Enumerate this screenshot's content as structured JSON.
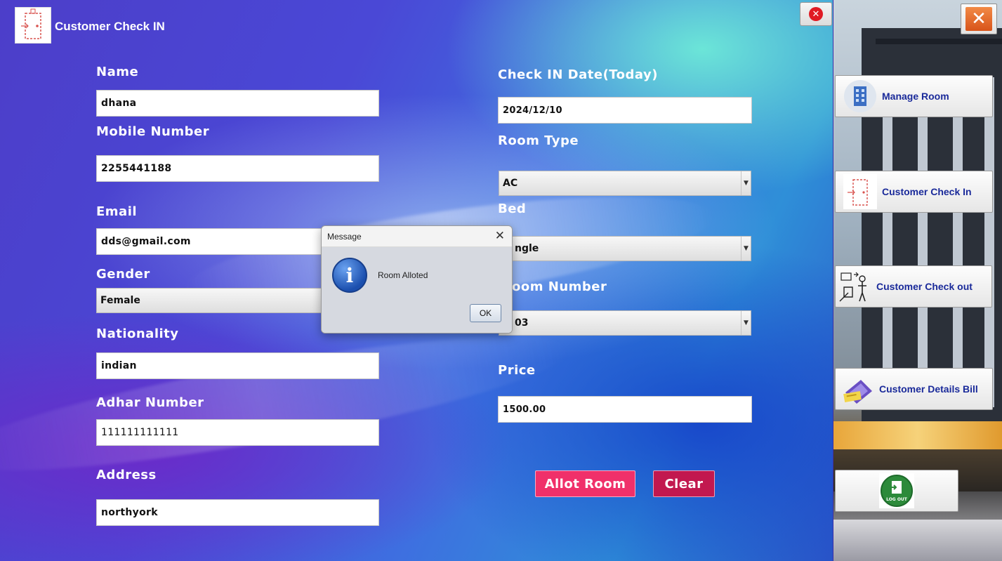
{
  "window": {
    "title": "Customer Check IN"
  },
  "form": {
    "name_label": "Name",
    "name_value": "dhana",
    "mobile_label": "Mobile Number",
    "mobile_value": "2255441188",
    "email_label": "Email",
    "email_value": "dds@gmail.com",
    "gender_label": "Gender",
    "gender_value": "Female",
    "nationality_label": "Nationality",
    "nationality_value": "indian",
    "adhar_label": "Adhar Number",
    "adhar_value": "111111111111",
    "address_label": "Address",
    "address_value": "northyork",
    "checkin_label": "Check IN Date(Today)",
    "checkin_value": "2024/12/10",
    "room_type_label": "Room Type",
    "room_type_value": "AC",
    "bed_label": "Bed",
    "bed_value": "ngle",
    "room_number_label": "oom Number",
    "room_number_value": "03",
    "price_label": "Price",
    "price_value": "1500.00",
    "allot_button": "Allot Room",
    "clear_button": "Clear"
  },
  "sidebar": {
    "items": [
      {
        "label": "Manage Room",
        "icon": "building-icon"
      },
      {
        "label": "Customer Check In",
        "icon": "door-icon"
      },
      {
        "label": "Customer Check out",
        "icon": "checkout-icon"
      },
      {
        "label": "Customer Details Bill",
        "icon": "bill-icon"
      },
      {
        "label": "",
        "icon": "logout-icon",
        "icon_text": "LOG OUT"
      }
    ]
  },
  "dialog": {
    "title": "Message",
    "message": "Room Alloted",
    "ok_label": "OK",
    "close_glyph": "✕",
    "info_glyph": "i"
  },
  "colors": {
    "accent_button": "#f0306a",
    "clear_button": "#c2184f",
    "nav_text": "#1a2a9a"
  }
}
